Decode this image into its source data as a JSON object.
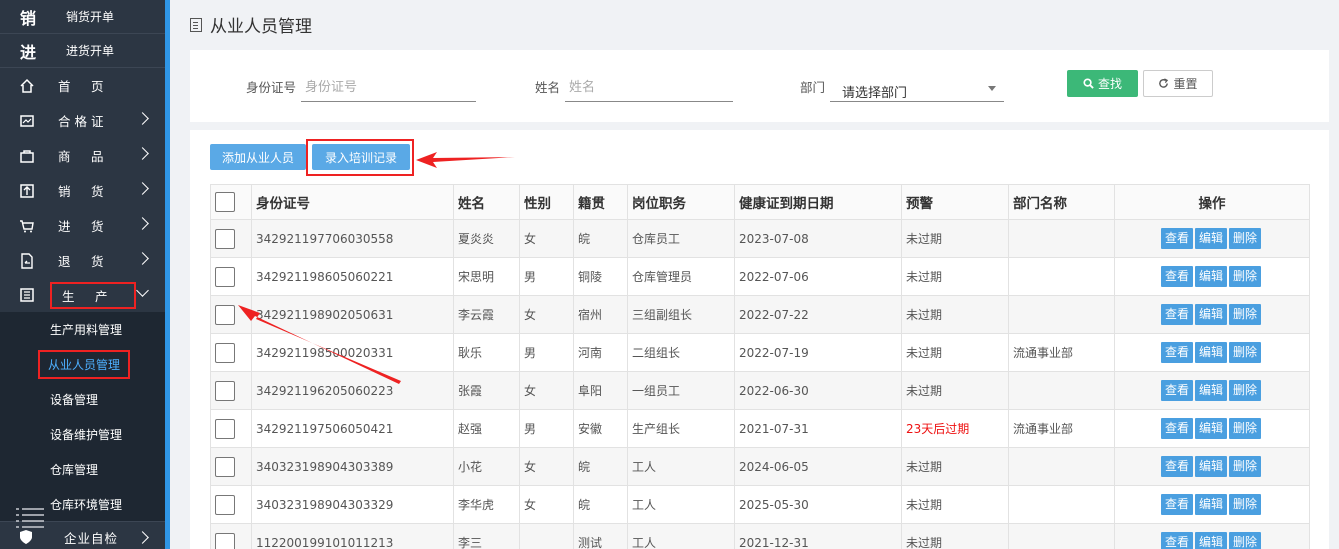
{
  "sidebar": {
    "quick": [
      {
        "big": "销",
        "label": "销货开单"
      },
      {
        "big": "进",
        "label": "进货开单"
      }
    ],
    "menu": [
      {
        "label": "首　页",
        "icon": "home-icon",
        "chevron": false
      },
      {
        "label": "合格证",
        "icon": "certificate-icon",
        "chevron": true
      },
      {
        "label": "商　品",
        "icon": "bag-icon",
        "chevron": true
      },
      {
        "label": "销　货",
        "icon": "upload-icon",
        "chevron": true
      },
      {
        "label": "进　货",
        "icon": "cart-icon",
        "chevron": true
      },
      {
        "label": "退　货",
        "icon": "return-doc-icon",
        "chevron": true
      },
      {
        "label": "生　产",
        "icon": "production-icon",
        "chevron": true,
        "open": true
      }
    ],
    "production_sub": [
      "生产用料管理",
      "从业人员管理",
      "设备管理",
      "设备维护管理",
      "仓库管理",
      "仓库环境管理"
    ],
    "active_sub": "从业人员管理",
    "last": {
      "label": "企业自检"
    }
  },
  "page": {
    "title": "从业人员管理"
  },
  "search": {
    "id_label": "身份证号",
    "id_placeholder": "身份证号",
    "name_label": "姓名",
    "name_placeholder": "姓名",
    "dept_label": "部门",
    "dept_value": "请选择部门",
    "search_btn": "查找",
    "reset_btn": "重置"
  },
  "toolbar": {
    "add_btn": "添加从业人员",
    "import_btn": "录入培训记录"
  },
  "table": {
    "headers": [
      "身份证号",
      "姓名",
      "性别",
      "籍贯",
      "岗位职务",
      "健康证到期日期",
      "预警",
      "部门名称",
      "操作"
    ],
    "ops": [
      "查看",
      "编辑",
      "删除"
    ],
    "rows": [
      {
        "id": "342921197706030558",
        "name": "夏炎炎",
        "sex": "女",
        "origin": "皖",
        "post": "仓库员工",
        "expiry": "2023-07-08",
        "warn": "未过期",
        "dept": ""
      },
      {
        "id": "342921198605060221",
        "name": "宋思明",
        "sex": "男",
        "origin": "铜陵",
        "post": "仓库管理员",
        "expiry": "2022-07-06",
        "warn": "未过期",
        "dept": ""
      },
      {
        "id": "342921198902050631",
        "name": "李云霞",
        "sex": "女",
        "origin": "宿州",
        "post": "三组副组长",
        "expiry": "2022-07-22",
        "warn": "未过期",
        "dept": ""
      },
      {
        "id": "342921198500020331",
        "name": "耿乐",
        "sex": "男",
        "origin": "河南",
        "post": "二组组长",
        "expiry": "2022-07-19",
        "warn": "未过期",
        "dept": "流通事业部"
      },
      {
        "id": "342921196205060223",
        "name": "张霞",
        "sex": "女",
        "origin": "阜阳",
        "post": "一组员工",
        "expiry": "2022-06-30",
        "warn": "未过期",
        "dept": ""
      },
      {
        "id": "342921197506050421",
        "name": "赵强",
        "sex": "男",
        "origin": "安徽",
        "post": "生产组长",
        "expiry": "2021-07-31",
        "warn": "23天后过期",
        "dept": "流通事业部",
        "warn_red": true
      },
      {
        "id": "340323198904303389",
        "name": "小花",
        "sex": "女",
        "origin": "皖",
        "post": "工人",
        "expiry": "2024-06-05",
        "warn": "未过期",
        "dept": ""
      },
      {
        "id": "340323198904303329",
        "name": "李华虎",
        "sex": "女",
        "origin": "皖",
        "post": "工人",
        "expiry": "2025-05-30",
        "warn": "未过期",
        "dept": ""
      },
      {
        "id": "112200199101011213",
        "name": "李三",
        "sex": "",
        "origin": "测试",
        "post": "工人",
        "expiry": "2021-12-31",
        "warn": "未过期",
        "dept": ""
      }
    ]
  },
  "colors": {
    "sidebar_bg": "#2c3643",
    "accent": "#2f96e6",
    "primary_btn": "#5aa9e6",
    "search_btn": "#3cb878",
    "annotation": "#e22222"
  }
}
